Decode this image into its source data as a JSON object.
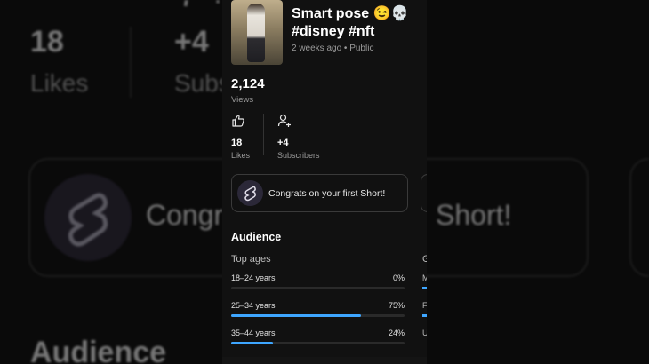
{
  "video": {
    "title": "Smart pose 😉💀 #disney #nft",
    "meta": "2 weeks ago • Public"
  },
  "views": {
    "value": "2,124",
    "label": "Views"
  },
  "likes": {
    "value": "18",
    "label": "Likes",
    "icon": "thumbs-up-icon"
  },
  "subscribers": {
    "value": "+4",
    "label": "Subscribers",
    "icon": "add-person-icon"
  },
  "congrats": {
    "text": "Congrats on your first Short!",
    "icon": "shorts-logo-icon"
  },
  "audience": {
    "heading": "Audience",
    "top_ages_heading": "Top ages",
    "side_heading_partial": "G",
    "ages": [
      {
        "label": "18–24 years",
        "percent": "0%",
        "fraction": 0.0
      },
      {
        "label": "25–34 years",
        "percent": "75%",
        "fraction": 0.75
      },
      {
        "label": "35–44 years",
        "percent": "24%",
        "fraction": 0.24
      }
    ],
    "side_partials": [
      "M",
      "F",
      "U"
    ]
  },
  "background": {
    "likes_value": "18",
    "likes_label": "Likes",
    "subs_value": "+4",
    "subs_label_partial": "Subs",
    "congrats_partial": "Congr",
    "short_partial": "Short!",
    "audience_partial": "Audience",
    "top_partial": "7 +"
  },
  "colors": {
    "accent": "#3ea6ff",
    "panel": "#111111",
    "background": "#0a0a0a"
  }
}
